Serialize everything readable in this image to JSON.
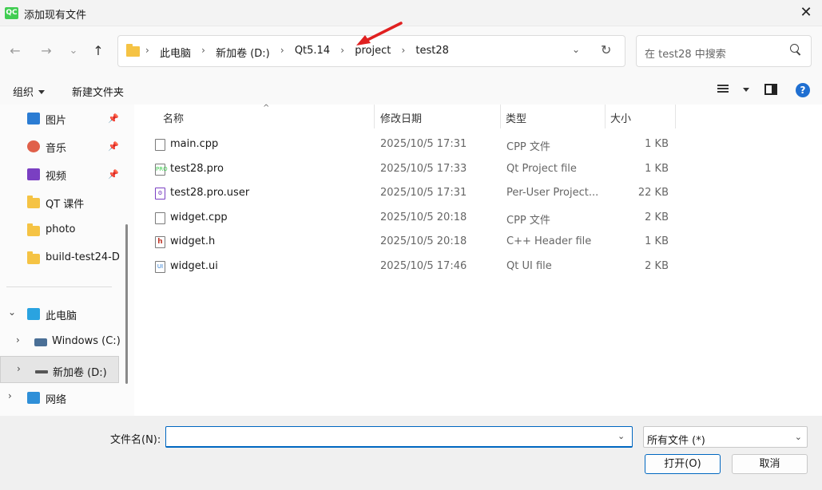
{
  "window": {
    "title": "添加现有文件",
    "logo_text": "QC",
    "close_label": "✕"
  },
  "nav": {
    "back": "←",
    "forward": "→",
    "recent": "⌄",
    "up": "↑",
    "breadcrumbs": [
      "此电脑",
      "新加卷 (D:)",
      "Qt5.14",
      "project",
      "test28"
    ],
    "search_placeholder": "在 test28 中搜索"
  },
  "toolbar": {
    "organize_label": "组织",
    "new_folder_label": "新建文件夹",
    "help_label": "?"
  },
  "sidebar": {
    "items": [
      {
        "label": "图片",
        "icon": "pictures-icon",
        "pinned": true
      },
      {
        "label": "音乐",
        "icon": "music-icon",
        "pinned": true
      },
      {
        "label": "视频",
        "icon": "videos-icon",
        "pinned": true
      },
      {
        "label": "QT 课件",
        "icon": "folder-icon"
      },
      {
        "label": "photo",
        "icon": "folder-icon"
      },
      {
        "label": "build-test24-D",
        "icon": "folder-icon"
      },
      {
        "label": "此电脑",
        "icon": "computer-icon"
      },
      {
        "label": "Windows (C:)",
        "icon": "windows-drive-icon"
      },
      {
        "label": "新加卷 (D:)",
        "icon": "drive-icon",
        "selected": true
      },
      {
        "label": "网络",
        "icon": "network-icon"
      }
    ]
  },
  "filelist": {
    "columns": [
      "名称",
      "修改日期",
      "类型",
      "大小"
    ],
    "rows": [
      {
        "name": "main.cpp",
        "date": "2025/10/5 17:31",
        "type": "CPP 文件",
        "size": "1 KB",
        "icon": "cpp-file-icon"
      },
      {
        "name": "test28.pro",
        "date": "2025/10/5 17:33",
        "type": "Qt Project file",
        "size": "1 KB",
        "icon": "pro-file-icon"
      },
      {
        "name": "test28.pro.user",
        "date": "2025/10/5 17:31",
        "type": "Per-User Project...",
        "size": "22 KB",
        "icon": "user-file-icon"
      },
      {
        "name": "widget.cpp",
        "date": "2025/10/5 20:18",
        "type": "CPP 文件",
        "size": "2 KB",
        "icon": "cpp-file-icon"
      },
      {
        "name": "widget.h",
        "date": "2025/10/5 20:18",
        "type": "C++ Header file",
        "size": "1 KB",
        "icon": "header-file-icon"
      },
      {
        "name": "widget.ui",
        "date": "2025/10/5 17:46",
        "type": "Qt UI file",
        "size": "2 KB",
        "icon": "ui-file-icon"
      }
    ]
  },
  "bottom": {
    "filename_label": "文件名(N):",
    "filename_value": "",
    "filetype_value": "所有文件 (*)",
    "open_label": "打开(O)",
    "cancel_label": "取消"
  },
  "colors": {
    "accent": "#0067c0",
    "annotation_arrow": "#e02020",
    "folder": "#f5c344"
  }
}
